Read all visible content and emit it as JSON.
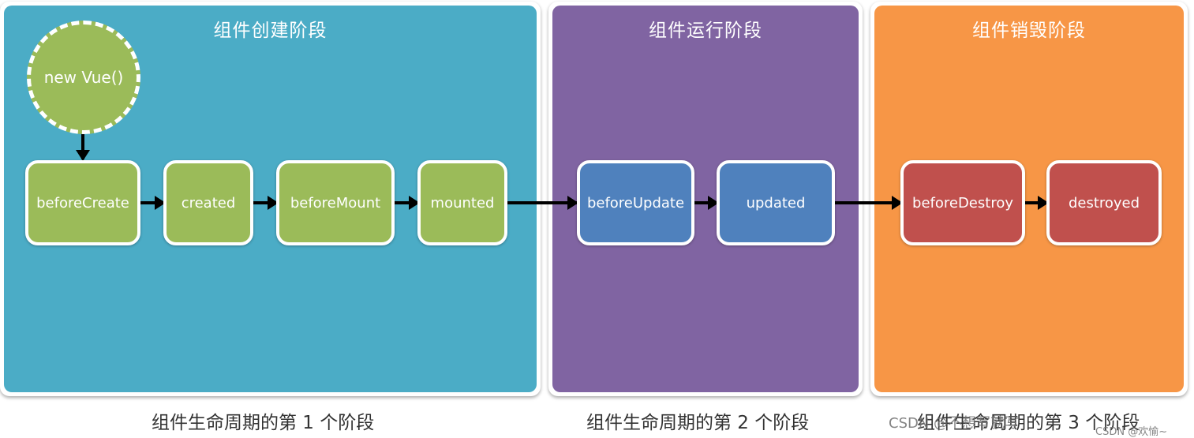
{
  "colors": {
    "creation_panel": "#4bacc6",
    "running_panel": "#8064a2",
    "destroy_panel": "#f79646",
    "create_nodes": "#9bbb59",
    "update_nodes": "#4f81bd",
    "destroy_nodes": "#c0504d"
  },
  "start_node": {
    "label": "new Vue()"
  },
  "phases": [
    {
      "title": "组件创建阶段",
      "caption": "组件生命周期的第 1 个阶段",
      "hooks": [
        "beforeCreate",
        "created",
        "beforeMount",
        "mounted"
      ]
    },
    {
      "title": "组件运行阶段",
      "caption": "组件生命周期的第 2 个阶段",
      "hooks": [
        "beforeUpdate",
        "updated"
      ]
    },
    {
      "title": "组件销毁阶段",
      "caption": "组件生命周期的第 3 个阶段",
      "hooks": [
        "beforeDestroy",
        "destroyed"
      ]
    }
  ],
  "watermarks": [
    "CSDN @不想写就写",
    "CSDN @欢愉~"
  ]
}
